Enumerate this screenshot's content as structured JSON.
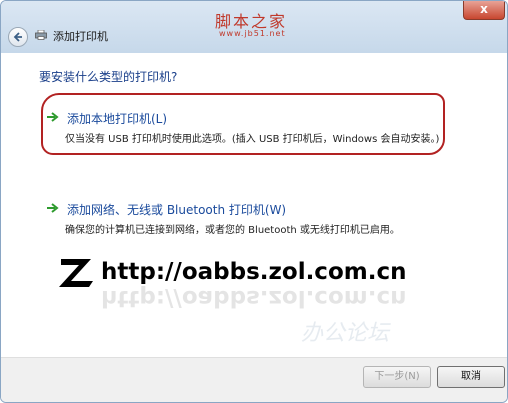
{
  "titlebar": {
    "brand": "脚本之家",
    "brand_url": "www.jb51.net",
    "close_label": "x"
  },
  "wizard": {
    "title": "添加打印机",
    "question": "要安装什么类型的打印机?"
  },
  "options": [
    {
      "title": "添加本地打印机(L)",
      "description": "仅当没有 USB 打印机时使用此选项。(插入 USB 打印机后，Windows 会自动安装。)",
      "highlighted": true
    },
    {
      "title": "添加网络、无线或 Bluetooth 打印机(W)",
      "description": "确保您的计算机已连接到网络，或者您的 Bluetooth 或无线打印机已启用。",
      "highlighted": false
    }
  ],
  "watermark": {
    "url": "http://oabbs.zol.com.cn",
    "site_text": "办公论坛"
  },
  "footer": {
    "next_label": "下一步(N)",
    "cancel_label": "取消"
  },
  "colors": {
    "title_text": "#1a4a9c",
    "option_arrow": "#2e9b2e",
    "highlight_ring": "#b22222",
    "brand": "#c0392b"
  },
  "icons": {
    "back": "back-arrow-icon",
    "wizard": "printer-icon",
    "option_arrow": "green-arrow-icon",
    "watermark_logo": "zol-logo-icon"
  }
}
